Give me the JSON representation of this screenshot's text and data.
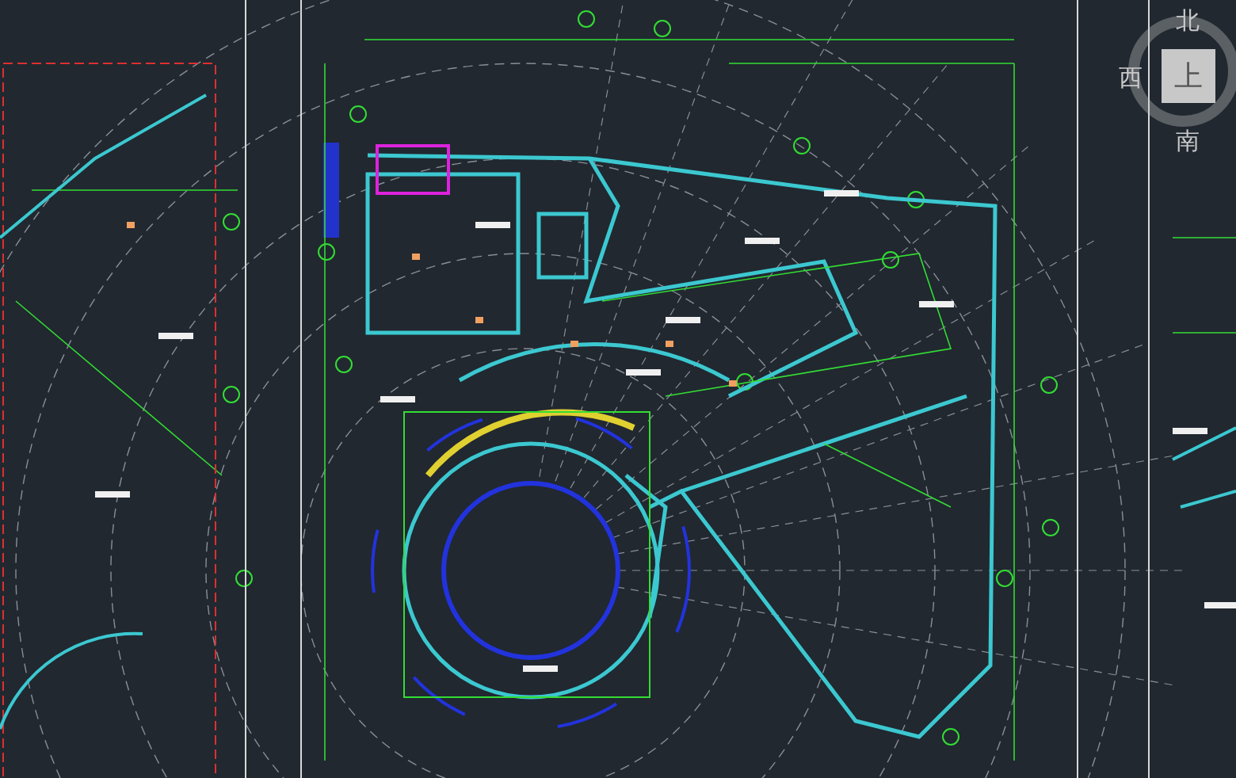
{
  "viewcube": {
    "north": "北",
    "west": "西",
    "top": "上",
    "south": "南"
  }
}
